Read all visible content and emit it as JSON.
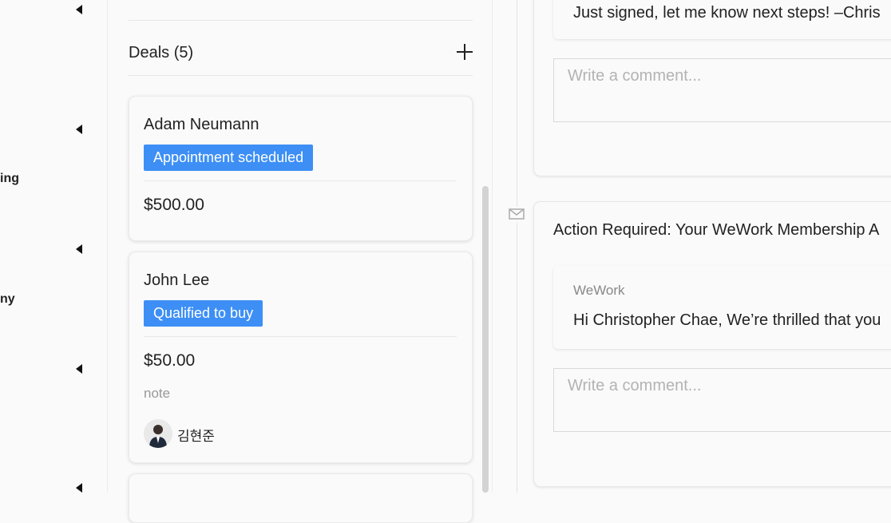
{
  "sidebar": {
    "labels": [
      "ing",
      "ny"
    ]
  },
  "deals": {
    "title": "Deals (5)",
    "cards": [
      {
        "name": "Adam Neumann",
        "stage": "Appointment scheduled",
        "amount": "$500.00"
      },
      {
        "name": "John Lee",
        "stage": "Qualified to buy",
        "amount": "$50.00",
        "note": "note",
        "owner": "김현준"
      }
    ]
  },
  "timeline": {
    "items": [
      {
        "body": "Just signed, let me know next steps! –Chris",
        "comment_placeholder": "Write a comment..."
      },
      {
        "icon": "mail-icon",
        "subject": "Action Required: Your WeWork Membership A",
        "sender": "WeWork",
        "body": "Hi Christopher Chae, We’re thrilled that you",
        "comment_placeholder": "Write a comment..."
      }
    ]
  },
  "colors": {
    "tag_blue": "#3d8ff5"
  }
}
